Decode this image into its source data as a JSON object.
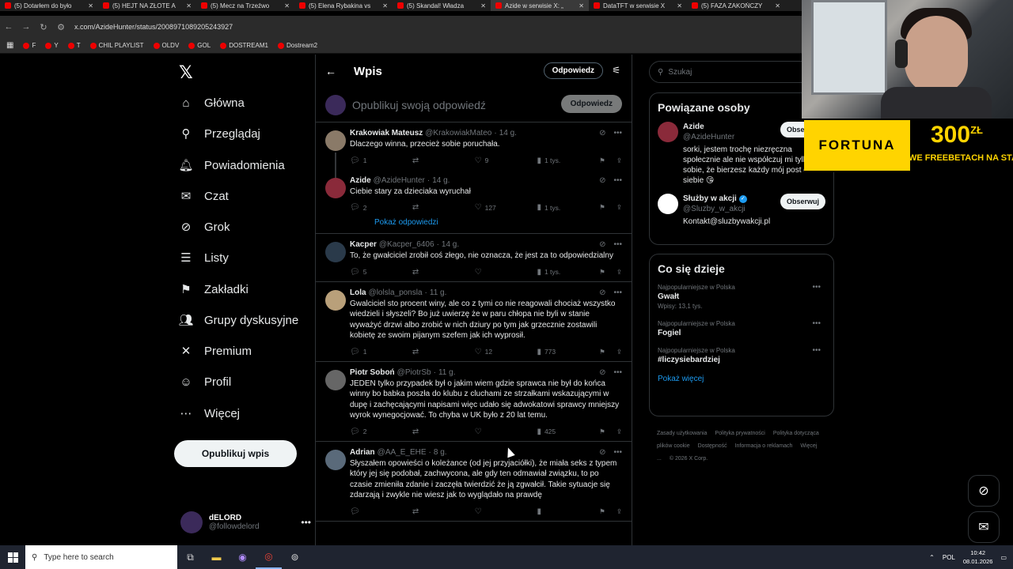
{
  "browser": {
    "tabs": [
      {
        "title": "(5) Dotarłem do było",
        "active": false
      },
      {
        "title": "(5) HEJT NA ZŁOTE A",
        "active": false
      },
      {
        "title": "(5) Mecz na Trzeźwo",
        "active": false
      },
      {
        "title": "(5) Elena Rybakina vs",
        "active": false
      },
      {
        "title": "(5) Skandal! Władza",
        "active": false
      },
      {
        "title": "Azide w serwisie X: „",
        "active": true
      },
      {
        "title": "DataTFT w serwisie X",
        "active": false
      },
      {
        "title": "(5) FAZA ZAKOŃCZY",
        "active": false
      }
    ],
    "url": "x.com/AzideHunter/status/2008971089205243927",
    "bookmarks": [
      "F",
      "Y",
      "T",
      "CHIL PLAYLIST",
      "OLDV",
      "GOL",
      "DOSTREAM1",
      "Dostream2"
    ]
  },
  "nav": {
    "items": [
      {
        "label": "Główna",
        "icon": "home-icon",
        "glyph": "⌂"
      },
      {
        "label": "Przeglądaj",
        "icon": "search-icon",
        "glyph": "⚲"
      },
      {
        "label": "Powiadomienia",
        "icon": "bell-icon",
        "glyph": "🔔︎"
      },
      {
        "label": "Czat",
        "icon": "mail-icon",
        "glyph": "✉"
      },
      {
        "label": "Grok",
        "icon": "grok-icon",
        "glyph": "⊘"
      },
      {
        "label": "Listy",
        "icon": "list-icon",
        "glyph": "☰"
      },
      {
        "label": "Zakładki",
        "icon": "bookmark-icon",
        "glyph": "⚑"
      },
      {
        "label": "Grupy dyskusyjne",
        "icon": "community-icon",
        "glyph": "👥︎"
      },
      {
        "label": "Premium",
        "icon": "x-premium-icon",
        "glyph": "✕"
      },
      {
        "label": "Profil",
        "icon": "profile-icon",
        "glyph": "☺"
      },
      {
        "label": "Więcej",
        "icon": "more-circle-icon",
        "glyph": "⋯"
      }
    ],
    "post_button": "Opublikuj wpis",
    "account": {
      "name": "dELORD",
      "handle": "@followdelord"
    }
  },
  "center": {
    "title": "Wpis",
    "reply_pill": "Odpowiedz",
    "compose_placeholder": "Opublikuj swoją odpowiedź",
    "compose_button": "Odpowiedz",
    "show_replies": "Pokaż odpowiedzi",
    "tweets": [
      {
        "name": "Krakowiak Mateusz",
        "handle": "@KrakowiakMateo",
        "time": "14 g.",
        "text": "Dlaczego winna, przecież sobie poruchała.",
        "replies": "1",
        "retweets": "",
        "likes": "9",
        "views": "1 tys."
      },
      {
        "name": "Azide",
        "handle": "@AzideHunter",
        "time": "14 g.",
        "text": "Ciebie stary za dzieciaka wyruchał",
        "replies": "2",
        "retweets": "",
        "likes": "127",
        "views": "1 tys."
      },
      {
        "name": "Kacper",
        "handle": "@Kacper_6406",
        "time": "14 g.",
        "text": "To, że gwałciciel zrobił coś złego, nie oznacza, że jest za to odpowiedzialny",
        "replies": "5",
        "retweets": "",
        "likes": "",
        "views": "1 tys."
      },
      {
        "name": "Lola",
        "handle": "@lolsla_ponsla",
        "time": "11 g.",
        "text": "Gwalciciel sto procent winy, ale co z tymi co nie reagowali chociaż wszystko wiedzieli i słyszeli? Bo już uwierzę że w paru chłopa nie byli w stanie wyważyć drzwi albo zrobić w nich dziury po tym jak grzecznie zostawili kobietę ze swoim pijanym szefem jak ich wyprosił.",
        "replies": "1",
        "retweets": "",
        "likes": "12",
        "views": "773"
      },
      {
        "name": "Piotr Soboń",
        "handle": "@PiotrSb",
        "time": "11 g.",
        "text": "JEDEN tylko przypadek był o jakim wiem gdzie sprawca nie był do końca winny bo babka poszła do klubu z cluchami ze strzałkami wskazującymi w dupę i zachęcającymi napisami więc udało się adwokatowi sprawcy mniejszy wyrok wynegocjować. To chyba w UK było z 20 lat temu.",
        "replies": "2",
        "retweets": "",
        "likes": "",
        "views": "425"
      },
      {
        "name": "Adrian",
        "handle": "@AA_E_EHE",
        "time": "8 g.",
        "text": "Słyszałem opowieści o koleżance (od jej przyjaciółki), że miała seks z typem który jej się podobał, zachwycona, ale gdy ten odmawiał związku, to po czasie zmieniła zdanie i zaczęła twierdzić że ją zgwałcił. Takie sytuacje się zdarzają i zwykle nie wiesz jak to wyglądało na prawdę",
        "replies": "",
        "retweets": "",
        "likes": "",
        "views": ""
      }
    ]
  },
  "right": {
    "search_placeholder": "Szukaj",
    "related": {
      "title": "Powiązane osoby",
      "people": [
        {
          "name": "Azide",
          "handle": "@AzideHunter",
          "bio": "sorki, jestem trochę niezręczna społecznie ale nie współczuj mi tylko sobie, że bierzesz każdy mój post do siebie 😘",
          "follow": "Obserwuj",
          "verified": false
        },
        {
          "name": "Służby w akcji",
          "handle": "@Sluzby_w_akcji",
          "bio": "Kontakt@sluzbywakcji.pl",
          "follow": "Obserwuj",
          "verified": true
        }
      ]
    },
    "trends": {
      "title": "Co się dzieje",
      "items": [
        {
          "context": "Najpopularniejsze w Polska",
          "topic": "Gwałt",
          "posts": "Wpisy: 13,1 tys."
        },
        {
          "context": "Najpopularniejsze w Polska",
          "topic": "Fogiel",
          "posts": ""
        },
        {
          "context": "Najpopularniejsze w Polska",
          "topic": "#liczysiebardziej",
          "posts": ""
        }
      ],
      "show_more": "Pokaż więcej"
    },
    "footer": [
      "Zasady użytkowania",
      "Polityka prywatności",
      "Polityka dotycząca plików cookie",
      "Dostępność",
      "Informacja o reklamach",
      "Więcej ...",
      "© 2026 X Corp."
    ]
  },
  "overlay": {
    "brand": "FORTUNA",
    "amount": "300",
    "currency": "ZŁ",
    "subtitle": "WE FREEBETACH NA START"
  },
  "taskbar": {
    "search_placeholder": "Type here to search",
    "language": "POL",
    "time": "10:42",
    "date": "08.01.2026"
  }
}
